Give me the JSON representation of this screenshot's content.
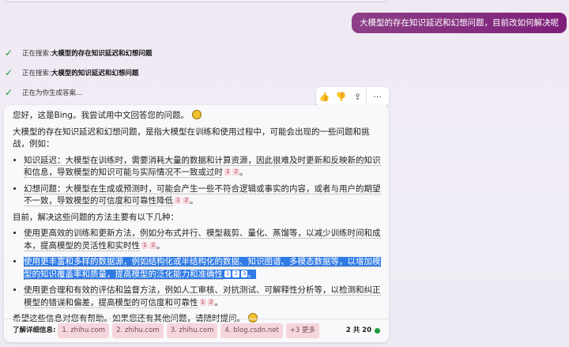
{
  "user_message": "大模型的存在知识延迟和幻想问题，目前改如何解决呢",
  "steps": [
    {
      "prefix": "正在搜索: ",
      "query": "大模型的存在知识延迟和幻想问题"
    },
    {
      "prefix": "正在搜索: ",
      "query": "大模型的知识延迟和幻想问题"
    },
    {
      "prefix": "正在为你生成答案...",
      "query": ""
    }
  ],
  "actions": {
    "like": "👍",
    "dislike": "👎",
    "share": "⇪",
    "more": "···"
  },
  "answer": {
    "greeting": "您好，这是Bing。我尝试用中文回答您的问题。",
    "intro": "大模型的存在知识延迟和幻想问题，是指大模型在训练和使用过程中，可能会出现的一些问题和挑战，例如：",
    "problems": [
      {
        "text": "知识延迟：大模型在训练时，需要消耗大量的数据和计算资源，因此很难及时更新和反映新的知识和信息，导致模型的知识可能与实际情况不一致或过时",
        "refs": [
          "1",
          "2"
        ]
      },
      {
        "text": "幻想问题：大模型在生成或预测时，可能会产生一些不符合逻辑或事实的内容，或者与用户的期望不一致，导致模型的可信度和可靠性降低",
        "refs": [
          "1",
          "2"
        ]
      }
    ],
    "methods_intro": "目前，解决这些问题的方法主要有以下几种：",
    "methods": [
      {
        "text": "使用更高效的训练和更新方法，例如分布式并行、模型裁剪、量化、蒸馏等，以减少训练时间和成本，提高模型的灵活性和实时性",
        "refs": [
          "1",
          "2"
        ]
      },
      {
        "text": "使用更丰富和多样的数据源，例如结构化或半结构化的数据、知识图谱、多模态数据等，以增加模型的知识覆盖率和质量，提高模型的泛化能力和准确性",
        "refs": [
          "1",
          "2",
          "3"
        ]
      },
      {
        "text": "使用更合理和有效的评估和监督方法，例如人工审核、对抗测试、可解释性分析等，以检测和纠正模型的错误和偏差，提高模型的可信度和可靠性",
        "refs": [
          "1",
          "2"
        ]
      }
    ],
    "closing": "希望这些信息对您有帮助。如果您还有其他问题，请随时提问。",
    "period": "。"
  },
  "footer": {
    "label": "了解详细信息:",
    "sources": [
      "1. zhihu.com",
      "2. zhihu.com",
      "3. zhihu.com",
      "4. blog.csdn.net",
      "+3 更多"
    ],
    "count": "2 共 20"
  }
}
